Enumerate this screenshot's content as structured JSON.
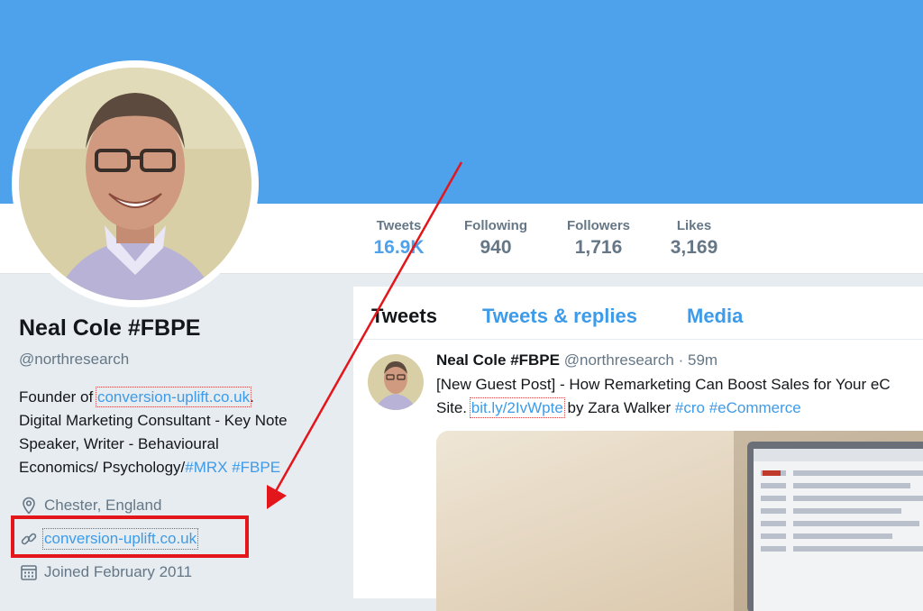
{
  "profile": {
    "name": "Neal Cole #FBPE",
    "handle": "@northresearch",
    "bio_line1_prefix": "Founder of ",
    "bio_line1_link": "conversion-uplift.co.uk",
    "bio_line1_suffix": ".",
    "bio_line2": "Digital Marketing Consultant - Key Note",
    "bio_line3": "Speaker, Writer - Behavioural",
    "bio_line4_prefix": "Economics/ Psychology/",
    "bio_line4_tag1": "#MRX",
    "bio_line4_tag2": "#FBPE",
    "location": "Chester, England",
    "website": "conversion-uplift.co.uk",
    "joined": "Joined February 2011"
  },
  "stats": [
    {
      "label": "Tweets",
      "value": "16.9K"
    },
    {
      "label": "Following",
      "value": "940"
    },
    {
      "label": "Followers",
      "value": "1,716"
    },
    {
      "label": "Likes",
      "value": "3,169"
    }
  ],
  "tabs": [
    {
      "label": "Tweets"
    },
    {
      "label": "Tweets & replies"
    },
    {
      "label": "Media"
    }
  ],
  "tweet": {
    "name": "Neal Cole #FBPE",
    "handle": "@northresearch",
    "time": "· 59m",
    "line1": "[New Guest Post] - How Remarketing Can Boost Sales for Your eC",
    "line2_prefix": "Site. ",
    "line2_link": "bit.ly/2IvWpte",
    "line2_mid": " by Zara Walker ",
    "tag1": "#cro",
    "tag2": "#eCommerce"
  },
  "colors": {
    "banner": "#4ea1eb",
    "link": "#3d9be9",
    "highlight_box": "#e3161b"
  },
  "icons": [
    "location-pin-icon",
    "link-icon",
    "calendar-icon"
  ]
}
